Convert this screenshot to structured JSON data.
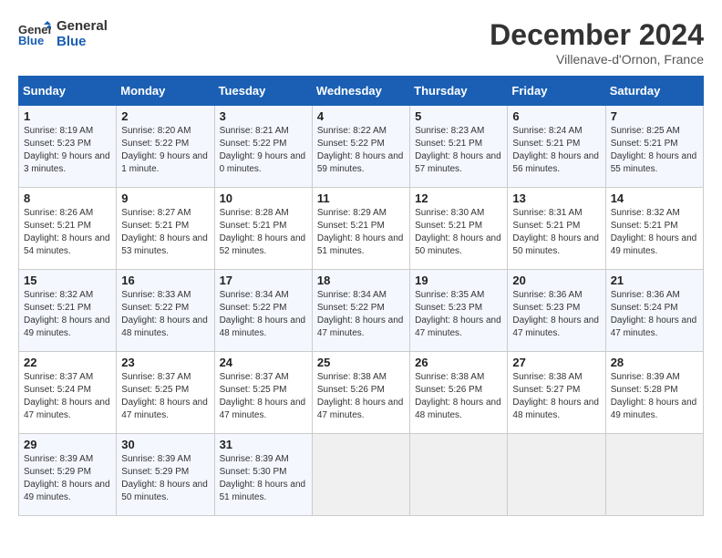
{
  "header": {
    "logo_line1": "General",
    "logo_line2": "Blue",
    "month_year": "December 2024",
    "location": "Villenave-d'Ornon, France"
  },
  "days_of_week": [
    "Sunday",
    "Monday",
    "Tuesday",
    "Wednesday",
    "Thursday",
    "Friday",
    "Saturday"
  ],
  "weeks": [
    [
      {
        "day": "1",
        "sunrise": "8:19 AM",
        "sunset": "5:23 PM",
        "daylight": "9 hours and 3 minutes."
      },
      {
        "day": "2",
        "sunrise": "8:20 AM",
        "sunset": "5:22 PM",
        "daylight": "9 hours and 1 minute."
      },
      {
        "day": "3",
        "sunrise": "8:21 AM",
        "sunset": "5:22 PM",
        "daylight": "9 hours and 0 minutes."
      },
      {
        "day": "4",
        "sunrise": "8:22 AM",
        "sunset": "5:22 PM",
        "daylight": "8 hours and 59 minutes."
      },
      {
        "day": "5",
        "sunrise": "8:23 AM",
        "sunset": "5:21 PM",
        "daylight": "8 hours and 57 minutes."
      },
      {
        "day": "6",
        "sunrise": "8:24 AM",
        "sunset": "5:21 PM",
        "daylight": "8 hours and 56 minutes."
      },
      {
        "day": "7",
        "sunrise": "8:25 AM",
        "sunset": "5:21 PM",
        "daylight": "8 hours and 55 minutes."
      }
    ],
    [
      {
        "day": "8",
        "sunrise": "8:26 AM",
        "sunset": "5:21 PM",
        "daylight": "8 hours and 54 minutes."
      },
      {
        "day": "9",
        "sunrise": "8:27 AM",
        "sunset": "5:21 PM",
        "daylight": "8 hours and 53 minutes."
      },
      {
        "day": "10",
        "sunrise": "8:28 AM",
        "sunset": "5:21 PM",
        "daylight": "8 hours and 52 minutes."
      },
      {
        "day": "11",
        "sunrise": "8:29 AM",
        "sunset": "5:21 PM",
        "daylight": "8 hours and 51 minutes."
      },
      {
        "day": "12",
        "sunrise": "8:30 AM",
        "sunset": "5:21 PM",
        "daylight": "8 hours and 50 minutes."
      },
      {
        "day": "13",
        "sunrise": "8:31 AM",
        "sunset": "5:21 PM",
        "daylight": "8 hours and 50 minutes."
      },
      {
        "day": "14",
        "sunrise": "8:32 AM",
        "sunset": "5:21 PM",
        "daylight": "8 hours and 49 minutes."
      }
    ],
    [
      {
        "day": "15",
        "sunrise": "8:32 AM",
        "sunset": "5:21 PM",
        "daylight": "8 hours and 49 minutes."
      },
      {
        "day": "16",
        "sunrise": "8:33 AM",
        "sunset": "5:22 PM",
        "daylight": "8 hours and 48 minutes."
      },
      {
        "day": "17",
        "sunrise": "8:34 AM",
        "sunset": "5:22 PM",
        "daylight": "8 hours and 48 minutes."
      },
      {
        "day": "18",
        "sunrise": "8:34 AM",
        "sunset": "5:22 PM",
        "daylight": "8 hours and 47 minutes."
      },
      {
        "day": "19",
        "sunrise": "8:35 AM",
        "sunset": "5:23 PM",
        "daylight": "8 hours and 47 minutes."
      },
      {
        "day": "20",
        "sunrise": "8:36 AM",
        "sunset": "5:23 PM",
        "daylight": "8 hours and 47 minutes."
      },
      {
        "day": "21",
        "sunrise": "8:36 AM",
        "sunset": "5:24 PM",
        "daylight": "8 hours and 47 minutes."
      }
    ],
    [
      {
        "day": "22",
        "sunrise": "8:37 AM",
        "sunset": "5:24 PM",
        "daylight": "8 hours and 47 minutes."
      },
      {
        "day": "23",
        "sunrise": "8:37 AM",
        "sunset": "5:25 PM",
        "daylight": "8 hours and 47 minutes."
      },
      {
        "day": "24",
        "sunrise": "8:37 AM",
        "sunset": "5:25 PM",
        "daylight": "8 hours and 47 minutes."
      },
      {
        "day": "25",
        "sunrise": "8:38 AM",
        "sunset": "5:26 PM",
        "daylight": "8 hours and 47 minutes."
      },
      {
        "day": "26",
        "sunrise": "8:38 AM",
        "sunset": "5:26 PM",
        "daylight": "8 hours and 48 minutes."
      },
      {
        "day": "27",
        "sunrise": "8:38 AM",
        "sunset": "5:27 PM",
        "daylight": "8 hours and 48 minutes."
      },
      {
        "day": "28",
        "sunrise": "8:39 AM",
        "sunset": "5:28 PM",
        "daylight": "8 hours and 49 minutes."
      }
    ],
    [
      {
        "day": "29",
        "sunrise": "8:39 AM",
        "sunset": "5:29 PM",
        "daylight": "8 hours and 49 minutes."
      },
      {
        "day": "30",
        "sunrise": "8:39 AM",
        "sunset": "5:29 PM",
        "daylight": "8 hours and 50 minutes."
      },
      {
        "day": "31",
        "sunrise": "8:39 AM",
        "sunset": "5:30 PM",
        "daylight": "8 hours and 51 minutes."
      },
      null,
      null,
      null,
      null
    ]
  ]
}
